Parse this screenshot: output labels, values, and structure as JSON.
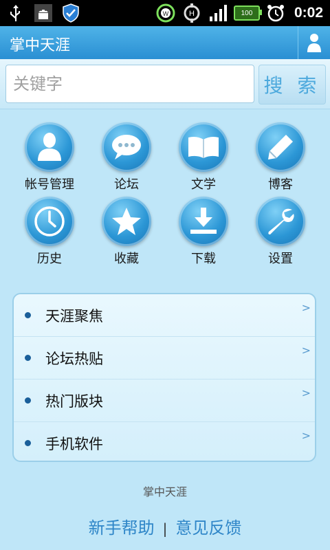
{
  "status_bar": {
    "time": "0:02",
    "battery": "100"
  },
  "app": {
    "title": "掌中天涯"
  },
  "search": {
    "placeholder": "关键字",
    "button_label": "搜 索"
  },
  "grid": [
    {
      "label": "帐号管理",
      "icon": "user-icon"
    },
    {
      "label": "论坛",
      "icon": "chat-bubble-icon"
    },
    {
      "label": "文学",
      "icon": "book-icon"
    },
    {
      "label": "博客",
      "icon": "pencil-icon"
    },
    {
      "label": "历史",
      "icon": "clock-icon"
    },
    {
      "label": "收藏",
      "icon": "star-icon"
    },
    {
      "label": "下载",
      "icon": "download-icon"
    },
    {
      "label": "设置",
      "icon": "wrench-icon"
    }
  ],
  "list": [
    {
      "label": "天涯聚焦"
    },
    {
      "label": "论坛热贴"
    },
    {
      "label": "热门版块"
    },
    {
      "label": "手机软件"
    }
  ],
  "footer": {
    "brand": "掌中天涯",
    "help": "新手帮助",
    "separator": "|",
    "feedback": "意见反馈"
  },
  "colors": {
    "title_bar": "#2a8fd3",
    "accent": "#2f86c8",
    "background": "#bfe6f8"
  }
}
